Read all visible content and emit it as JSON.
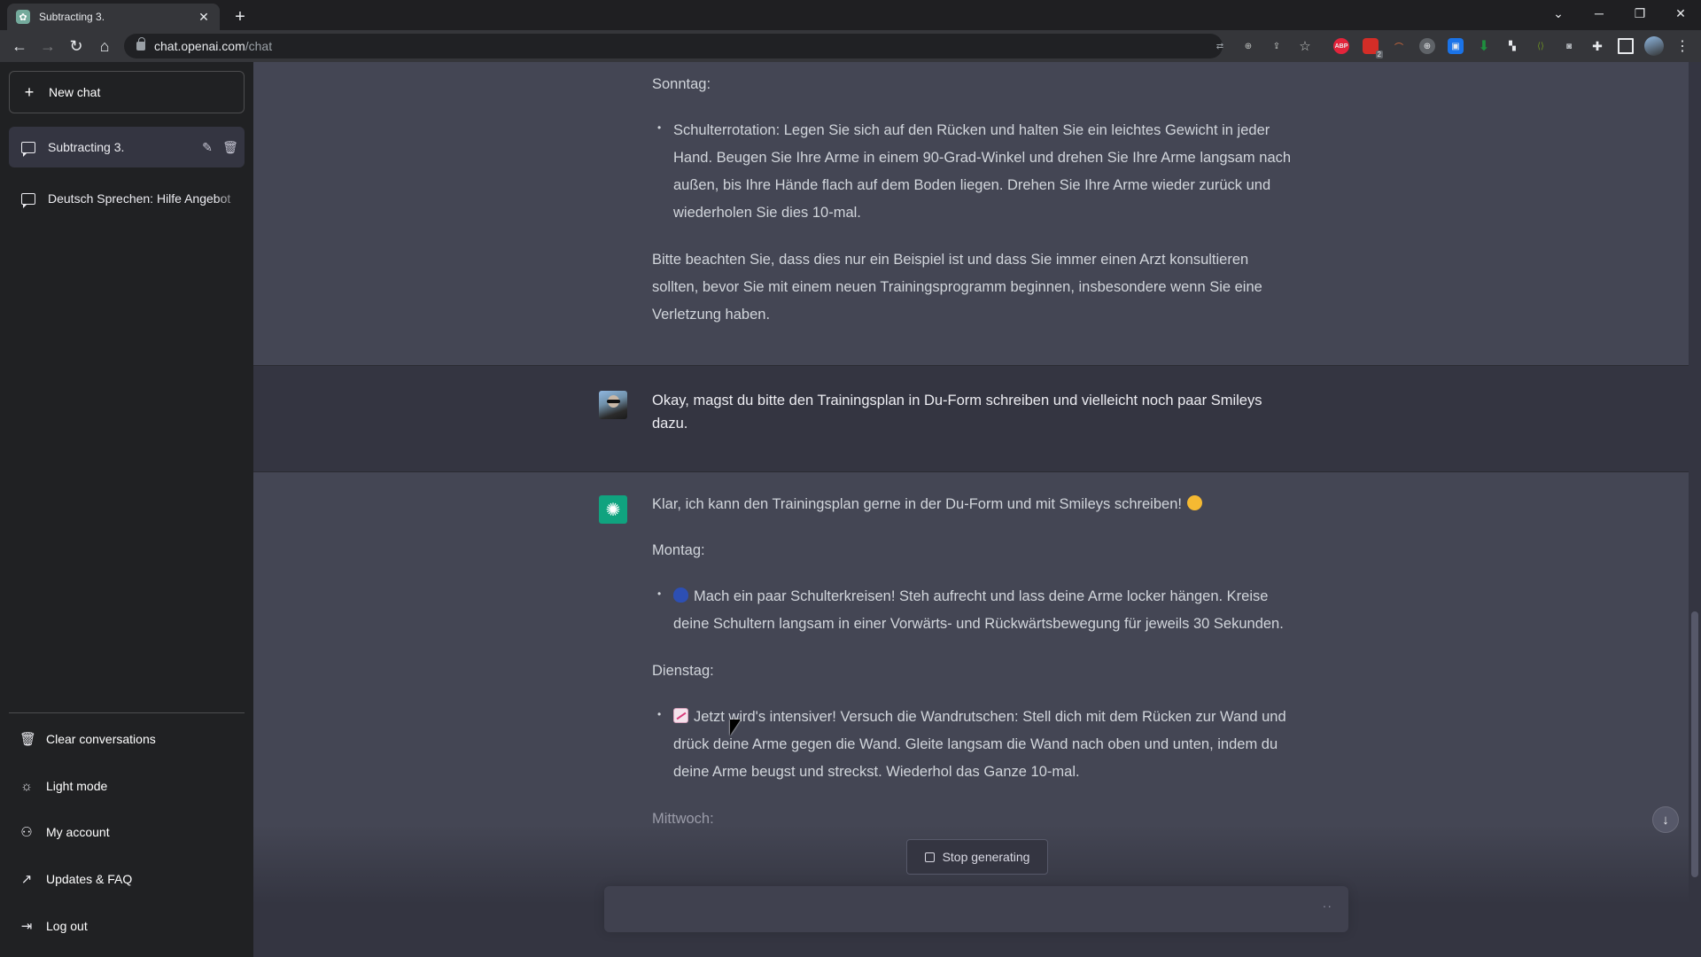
{
  "browser": {
    "tab_title": "Subtracting 3.",
    "url_host": "chat.openai.com",
    "url_path": "/chat",
    "extensions": [
      "translate-icon",
      "zoom-icon",
      "share-icon",
      "bookmark-star-icon",
      "adblock-icon",
      "lastpass-icon",
      "rainbow-icon",
      "vpn-icon",
      "bookmark-ext-icon",
      "download-icon",
      "ext-icon",
      "code-icon",
      "camera-icon",
      "puzzle-icon",
      "sidepanel-icon",
      "profile-avatar",
      "menu-icon"
    ],
    "abp_label": "ABP",
    "ext_badge": "2"
  },
  "sidebar": {
    "new_chat": "New chat",
    "conversations": [
      {
        "label": "Subtracting 3.",
        "active": true
      },
      {
        "label": "Deutsch Sprechen: Hilfe Angebot",
        "active": false
      }
    ],
    "menu": [
      {
        "label": "Clear conversations",
        "icon": "trash-icon"
      },
      {
        "label": "Light mode",
        "icon": "sun-icon"
      },
      {
        "label": "My account",
        "icon": "user-icon"
      },
      {
        "label": "Updates & FAQ",
        "icon": "external-link-icon"
      },
      {
        "label": "Log out",
        "icon": "logout-icon"
      }
    ]
  },
  "messages": {
    "prev_assistant": {
      "day": "Sonntag:",
      "bullet": "Schulterrotation: Legen Sie sich auf den Rücken und halten Sie ein leichtes Gewicht in jeder Hand. Beugen Sie Ihre Arme in einem 90-Grad-Winkel und drehen Sie Ihre Arme langsam nach außen, bis Ihre Hände flach auf dem Boden liegen. Drehen Sie Ihre Arme wieder zurück und wiederholen Sie dies 10-mal.",
      "note": "Bitte beachten Sie, dass dies nur ein Beispiel ist und dass Sie immer einen Arzt konsultieren sollten, bevor Sie mit einem neuen Trainingsprogramm beginnen, insbesondere wenn Sie eine Verletzung haben."
    },
    "user": {
      "text": "Okay, magst du bitte den Trainingsplan in Du-Form schreiben und vielleicht noch paar Smileys dazu."
    },
    "assistant": {
      "intro": "Klar, ich kann den Trainingsplan gerne in der Du-Form und mit Smileys schreiben!",
      "day1": "Montag:",
      "bullet1": "Mach ein paar Schulterkreisen! Steh aufrecht und lass deine Arme locker hängen. Kreise deine Schultern langsam in einer Vorwärts- und Rückwärtsbewegung für jeweils 30 Sekunden.",
      "day2": "Dienstag:",
      "bullet2": "Jetzt wird's intensiver! Versuch die Wandrutschen: Stell dich mit dem Rücken zur Wand und drück deine Arme gegen die Wand. Gleite langsam die Wand nach oben und unten, indem du deine Arme beugst und streckst. Wiederhol das Ganze 10-mal.",
      "day3": "Mittwoch:"
    }
  },
  "composer": {
    "stop_label": "Stop generating",
    "input_value": "",
    "typing_indicator": "··"
  },
  "colors": {
    "assistant_bg": "#444654",
    "user_bg": "#343541",
    "sidebar_bg": "#202123",
    "bot_avatar": "#10a37f"
  }
}
